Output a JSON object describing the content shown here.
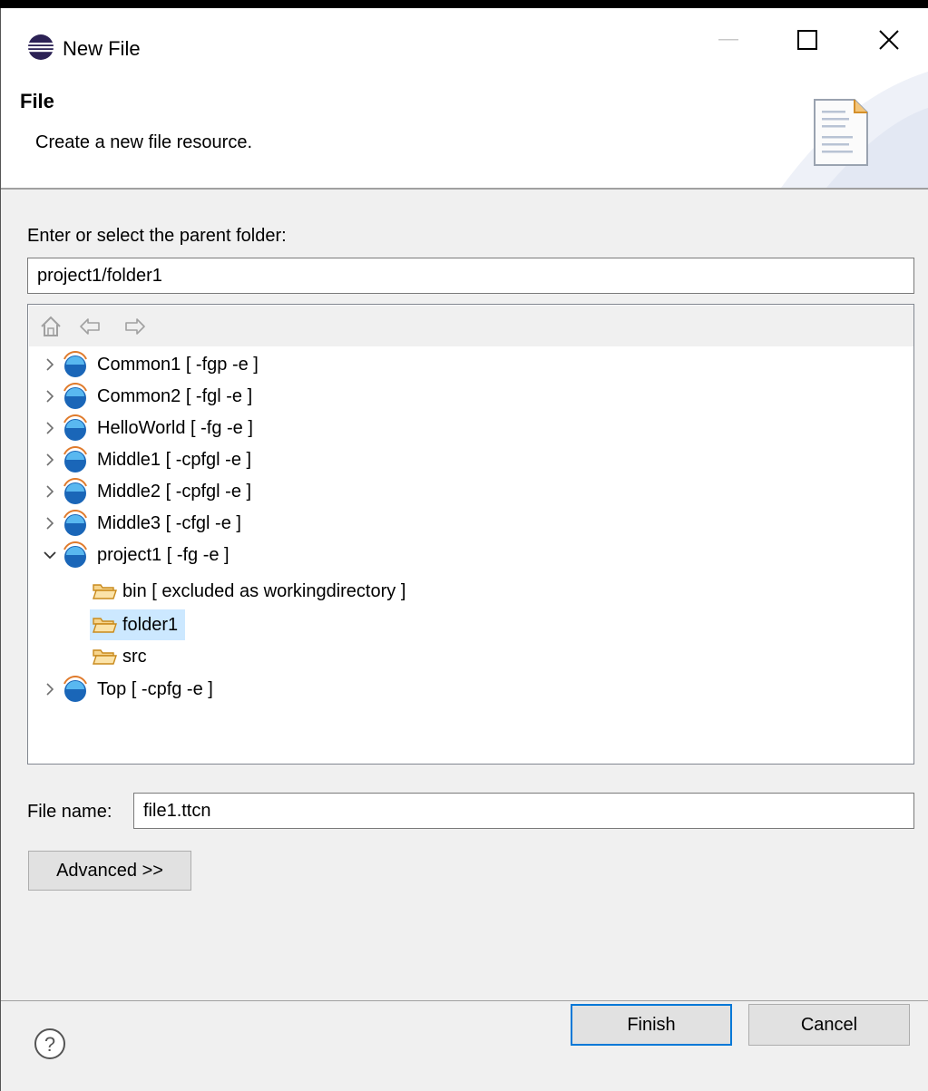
{
  "window": {
    "title": "New File"
  },
  "banner": {
    "title": "File",
    "description": "Create a new file resource."
  },
  "parent_folder": {
    "label": "Enter or select the parent folder:",
    "value": "project1/folder1"
  },
  "tree": {
    "toolbar_icons": [
      "home-icon",
      "back-arrow-icon",
      "forward-arrow-icon"
    ],
    "items": [
      {
        "label": "Common1 [ -fgp -e ]",
        "kind": "project",
        "expanded": false
      },
      {
        "label": "Common2 [ -fgl -e ]",
        "kind": "project",
        "expanded": false
      },
      {
        "label": "HelloWorld [ -fg -e ]",
        "kind": "project",
        "expanded": false
      },
      {
        "label": "Middle1 [ -cpfgl -e ]",
        "kind": "project",
        "expanded": false
      },
      {
        "label": "Middle2 [ -cpfgl -e ]",
        "kind": "project",
        "expanded": false
      },
      {
        "label": "Middle3 [ -cfgl -e ]",
        "kind": "project",
        "expanded": false
      },
      {
        "label": "project1 [ -fg -e ]",
        "kind": "project",
        "expanded": true
      },
      {
        "label": "bin [ excluded as workingdirectory ]",
        "kind": "folder"
      },
      {
        "label": "folder1",
        "kind": "folder",
        "selected": true
      },
      {
        "label": "src",
        "kind": "folder"
      },
      {
        "label": "Top [ -cpfg -e ]",
        "kind": "project",
        "expanded": false
      }
    ]
  },
  "file_name": {
    "label": "File name:",
    "value": "file1.ttcn"
  },
  "buttons": {
    "advanced": "Advanced >>",
    "finish": "Finish",
    "cancel": "Cancel"
  },
  "colors": {
    "selection": "#cce8ff",
    "default_button_border": "#0078d7",
    "folder": "#e8a93a"
  }
}
